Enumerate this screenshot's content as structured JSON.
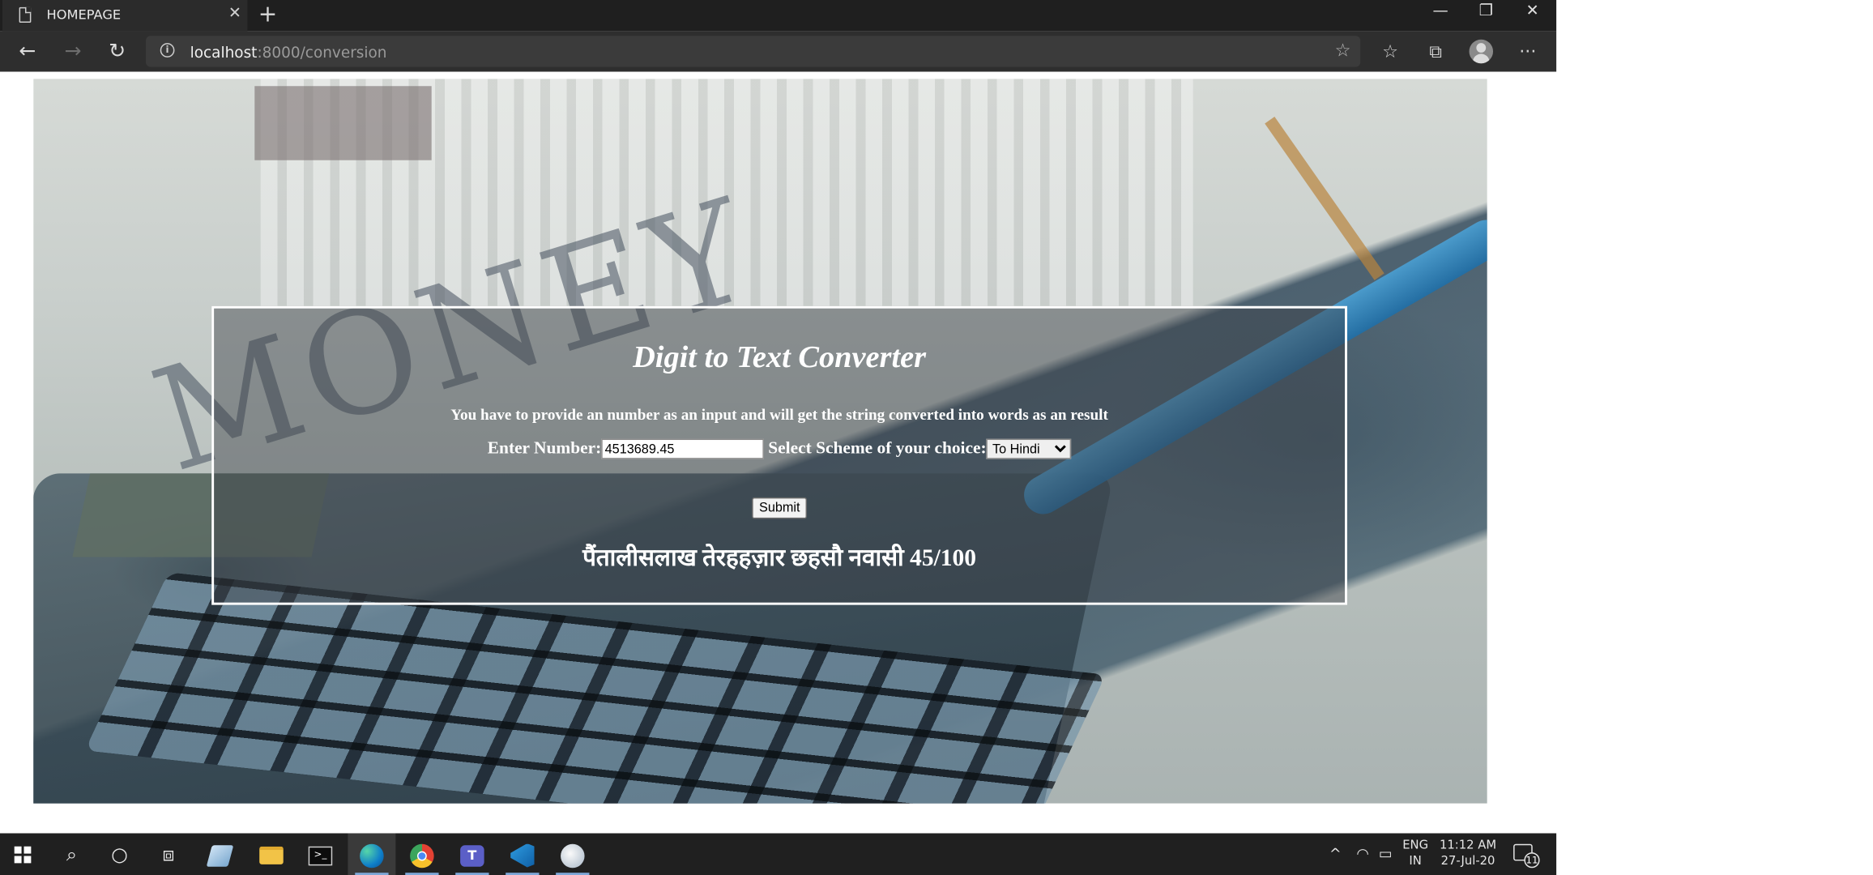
{
  "browser": {
    "tab_title": "HOMEPAGE",
    "tab_close": "✕",
    "new_tab": "+",
    "window_controls": {
      "minimize": "—",
      "restore": "❐",
      "close": "✕"
    },
    "nav": {
      "back": "←",
      "forward": "→",
      "refresh": "↻"
    },
    "address": {
      "host": "localhost",
      "rest": ":8000/conversion"
    },
    "toolbar_glyphs": {
      "favorite": "☆",
      "favorites": "☆",
      "collections": "⧉",
      "more": "···"
    }
  },
  "converter": {
    "title": "Digit to Text Converter",
    "description": "You have to provide an number as an input and will get the string converted into words as an result",
    "number_label": "Enter Number:",
    "number_value": "4513689.45",
    "scheme_label": "Select Scheme of your choice:",
    "scheme_selected": "To Hindi",
    "submit_label": "Submit",
    "result": "पैंतालीसलाख तेरहहज़ार छहसौ नवासी 45/100"
  },
  "taskbar": {
    "apps": [
      "start",
      "search",
      "cortana",
      "task-view",
      "notepad",
      "file-explorer",
      "terminal",
      "edge",
      "chrome",
      "teams",
      "vscode",
      "paint"
    ],
    "tray": {
      "chevron": "^",
      "language": "ENG",
      "region": "IN",
      "time": "11:12 AM",
      "date": "27-Jul-20",
      "notifications": "11"
    }
  },
  "colors": {
    "panel_border": "#ffffff",
    "taskbar": "#202020",
    "titlebar": "#1f1f1f"
  }
}
